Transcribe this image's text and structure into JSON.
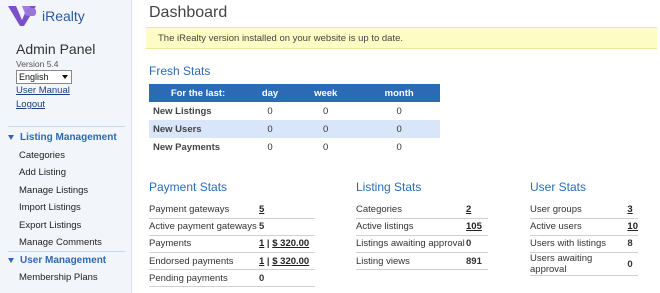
{
  "app": {
    "name": "iRealty"
  },
  "sidebar": {
    "title": "Admin Panel",
    "version": "Version 5.4",
    "language": "English",
    "user_manual": "User Manual",
    "logout": "Logout",
    "sections": [
      {
        "label": "Listing Management",
        "items": [
          "Categories",
          "Add Listing",
          "Manage Listings",
          "Import Listings",
          "Export Listings",
          "Manage Comments"
        ]
      },
      {
        "label": "User Management",
        "items": [
          "Membership Plans"
        ]
      }
    ]
  },
  "main": {
    "title": "Dashboard",
    "notice": "The iRealty version installed on your website is up to date.",
    "fresh_stats": {
      "title": "Fresh Stats",
      "headers": [
        "For the last:",
        "day",
        "week",
        "month"
      ],
      "rows": [
        [
          "New Listings",
          "0",
          "0",
          "0"
        ],
        [
          "New Users",
          "0",
          "0",
          "0"
        ],
        [
          "New Payments",
          "0",
          "0",
          "0"
        ]
      ]
    },
    "payment_stats": {
      "title": "Payment Stats",
      "rows": [
        {
          "label": "Payment gateways",
          "v1": "5"
        },
        {
          "label": "Active payment gateways",
          "v1": "5"
        },
        {
          "label": "Payments",
          "v1": "1",
          "sep": " | ",
          "v2": "$ 320.00"
        },
        {
          "label": "Endorsed payments",
          "v1": "1",
          "sep": " | ",
          "v2": "$ 320.00"
        },
        {
          "label": "Pending payments",
          "v1": "0"
        }
      ]
    },
    "listing_stats": {
      "title": "Listing Stats",
      "rows": [
        {
          "label": "Categories",
          "v1": "2"
        },
        {
          "label": "Active listings",
          "v1": "105"
        },
        {
          "label": "Listings awaiting approval",
          "v1": "0"
        },
        {
          "label": "Listing views",
          "v1": "891"
        }
      ]
    },
    "user_stats": {
      "title": "User Stats",
      "rows": [
        {
          "label": "User groups",
          "v1": "3"
        },
        {
          "label": "Active users",
          "v1": "10"
        },
        {
          "label": "Users with listings",
          "v1": "8"
        },
        {
          "label": "Users awaiting approval",
          "v1": "0"
        }
      ]
    }
  },
  "colors": {
    "accent": "#2b6bb5",
    "notice_bg": "#fdfcc4",
    "logo_purple": "#7b4fc8"
  }
}
